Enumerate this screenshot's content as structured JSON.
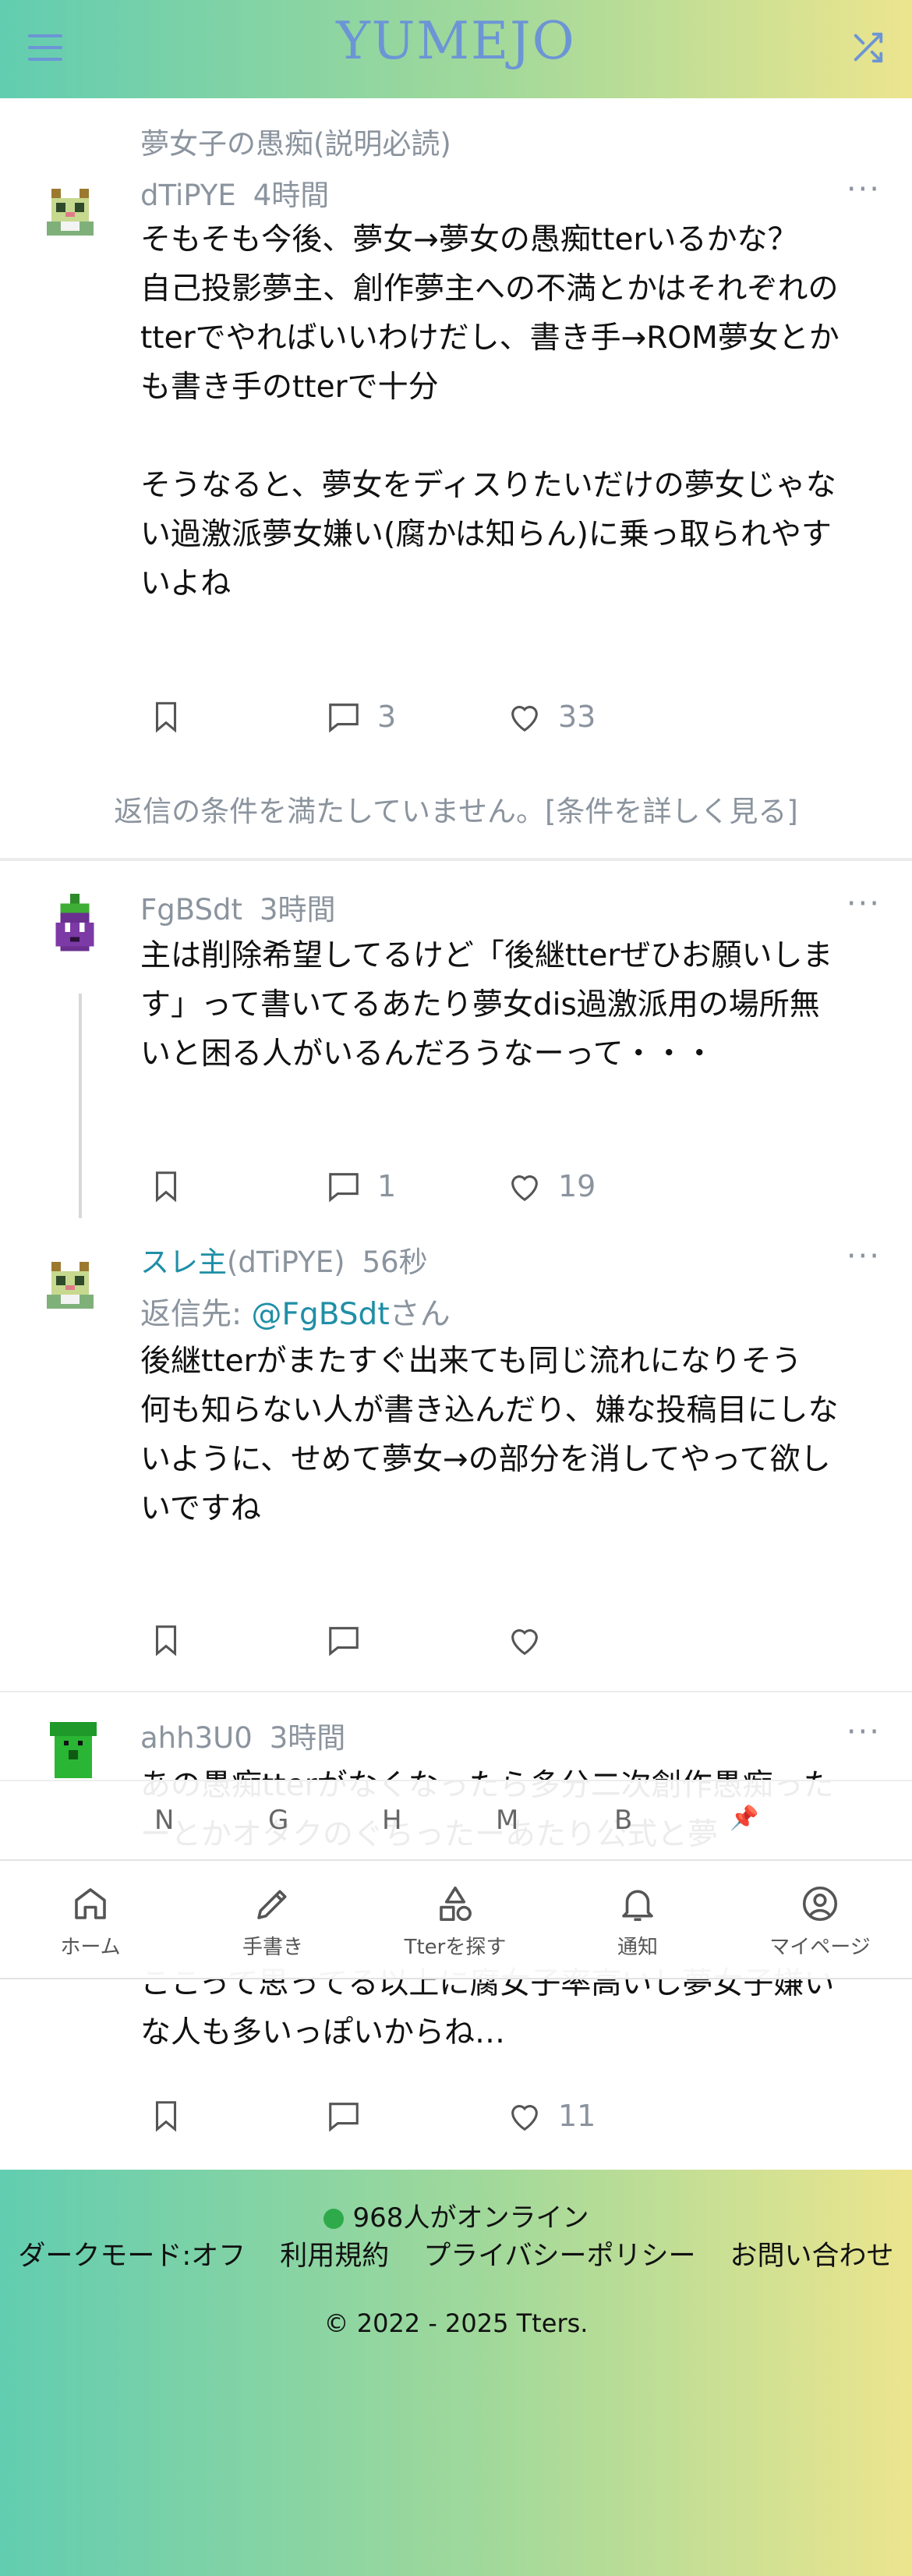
{
  "header": {
    "logo": "YUMEJO",
    "menu_icon": "hamburger-menu-icon",
    "shuffle_icon": "shuffle-icon"
  },
  "posts": [
    {
      "board": "夢女子の愚痴(説明必読)",
      "user": "dTiPYE",
      "time": "4時間",
      "body": "そもそも今後、夢女→夢女の愚痴tterいるかな？\n自己投影夢主、創作夢主への不満とかはそれぞれのtterでやればいいわけだし、書き手→ROM夢女とかも書き手のtterで十分\n\nそうなると、夢女をディスりたいだけの夢女じゃない過激派夢女嫌い(腐かは知らん)に乗っ取られやすいよね",
      "replies": "3",
      "likes": "33",
      "notice": "返信の条件を満たしていません。[条件を詳しく見る]"
    },
    {
      "user": "FgBSdt",
      "time": "3時間",
      "body": "主は削除希望してるけど「後継tterぜひお願いします」って書いてるあたり夢女dis過激派用の場所無いと困る人がいるんだろうなーって・・・",
      "replies": "1",
      "likes": "19"
    },
    {
      "author_label": "スレ主",
      "user": "(dTiPYE)",
      "time": "56秒",
      "reply_prefix": "返信先: ",
      "reply_to": "@FgBSdt",
      "reply_suffix": "さん",
      "body": "後継tterがまたすぐ出来ても同じ流れになりそう\n何も知らない人が書き込んだり、嫌な投稿目にしないように、せめて夢女→の部分を消してやって欲しいですね"
    },
    {
      "user": "ahh3U0",
      "time": "3時間",
      "body_hidden": "あの愚痴tterがなくなったら多分二次創作愚痴ったーとかオタクのぐちったーあたり公式と夢",
      "body": "ここって思ってる以上に腐女子率高いし夢女子嫌いな人も多いっぽいからね…",
      "likes": "11"
    }
  ],
  "alpha_nav": [
    "N",
    "G",
    "H",
    "M",
    "B",
    "📌"
  ],
  "bottom_nav": [
    {
      "label": "ホーム",
      "icon": "home-icon"
    },
    {
      "label": "手書き",
      "icon": "pen-icon"
    },
    {
      "label": "Tterを探す",
      "icon": "shapes-icon"
    },
    {
      "label": "通知",
      "icon": "bell-icon"
    },
    {
      "label": "マイページ",
      "icon": "user-circle-icon"
    }
  ],
  "footer": {
    "online": "968人がオンライン",
    "links": [
      "ダークモード:オフ",
      "利用規約",
      "プライバシーポリシー",
      "お問い合わせ"
    ],
    "copyright": "© 2022 - 2025 Tters."
  },
  "colors": {
    "accent_blue": "#6c95d6",
    "link_teal": "#1f8fa6",
    "online_green": "#2eaa4b",
    "gradient_start": "#62cdb0",
    "gradient_end": "#ece58e"
  }
}
